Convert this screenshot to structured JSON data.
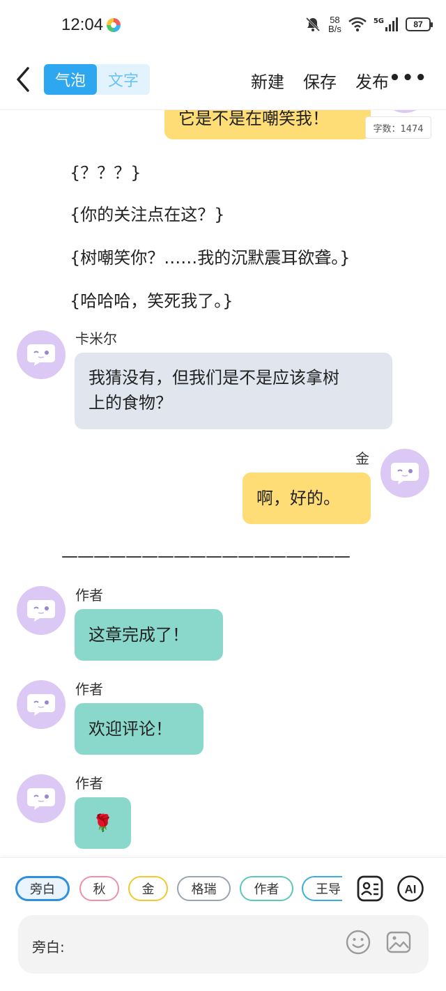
{
  "status_bar": {
    "time": "12:04",
    "net_speed_value": "58",
    "net_speed_unit": "B/s",
    "network": "5G",
    "battery": "87"
  },
  "toolbar": {
    "mode_tabs": [
      "气泡",
      "文字"
    ],
    "active_mode": "气泡",
    "actions": [
      "新建",
      "保存",
      "发布"
    ],
    "more": "•••"
  },
  "chat": {
    "partial_top_message": "它是不是在嘲笑我！",
    "word_count": "字数：1474",
    "narration": [
      "{？？？}",
      "{你的关注点在这？}",
      "{树嘲笑你？……我的沉默震耳欲聋。}",
      "{哈哈哈，笑死我了。}"
    ],
    "messages": [
      {
        "speaker": "卡米尔",
        "side": "left",
        "color": "gray",
        "lines": [
          "我猜没有，但我们是不是应该拿树",
          "上的食物？"
        ]
      },
      {
        "speaker": "金",
        "side": "right",
        "color": "yellow",
        "lines": [
          "啊，好的。"
        ]
      },
      {
        "speaker": "作者",
        "side": "left",
        "color": "teal",
        "lines": [
          "这章完成了！"
        ]
      },
      {
        "speaker": "作者",
        "side": "left",
        "color": "teal",
        "lines": [
          "欢迎评论！"
        ]
      },
      {
        "speaker": "作者",
        "side": "left",
        "color": "teal",
        "lines": [
          "🌹"
        ]
      }
    ],
    "divider": "——————————————————"
  },
  "roles": [
    {
      "name": "旁白",
      "color": "#2e8fe0",
      "active": true
    },
    {
      "name": "秋",
      "color": "#f090a8",
      "active": false
    },
    {
      "name": "金",
      "color": "#f0c830",
      "active": false
    },
    {
      "name": "格瑞",
      "color": "#9aa4b0",
      "active": false
    },
    {
      "name": "作者",
      "color": "#5cc8b8",
      "active": false
    },
    {
      "name": "王导",
      "color": "#3aaee0",
      "active": false
    }
  ],
  "input": {
    "label": "旁白:",
    "placeholder": ""
  },
  "icons": {
    "role_manage": "contacts-card-icon",
    "ai": "ai-icon",
    "emoji": "emoji-icon",
    "image": "image-icon"
  }
}
